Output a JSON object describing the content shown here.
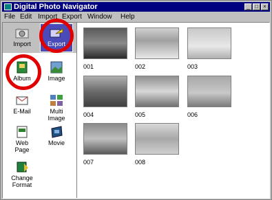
{
  "window": {
    "title": "Digital Photo Navigator"
  },
  "menu": [
    "File",
    "Edit",
    "Import",
    "Export",
    "Window",
    "Help"
  ],
  "sidebar": {
    "top": [
      {
        "label": "Import",
        "icon": "import-icon"
      },
      {
        "label": "Export",
        "icon": "export-icon"
      }
    ],
    "items": [
      {
        "label": "Album",
        "icon": "album-icon"
      },
      {
        "label": "Image",
        "icon": "image-icon"
      },
      {
        "label": "E-Mail",
        "icon": "email-icon"
      },
      {
        "label": "Multi\nImage",
        "icon": "multi-image-icon"
      },
      {
        "label": "Web\nPage",
        "icon": "web-page-icon"
      },
      {
        "label": "Movie",
        "icon": "movie-icon"
      },
      {
        "label": "Change\nFormat",
        "icon": "change-format-icon"
      }
    ]
  },
  "thumbnails": [
    {
      "caption": "001"
    },
    {
      "caption": "002"
    },
    {
      "caption": "003"
    },
    {
      "caption": "004"
    },
    {
      "caption": "005"
    },
    {
      "caption": "006"
    },
    {
      "caption": "007"
    },
    {
      "caption": "008"
    }
  ],
  "colors": {
    "titlebar": "#000080",
    "highlight_circle": "#e00000",
    "window_face": "#c0c0c0"
  }
}
